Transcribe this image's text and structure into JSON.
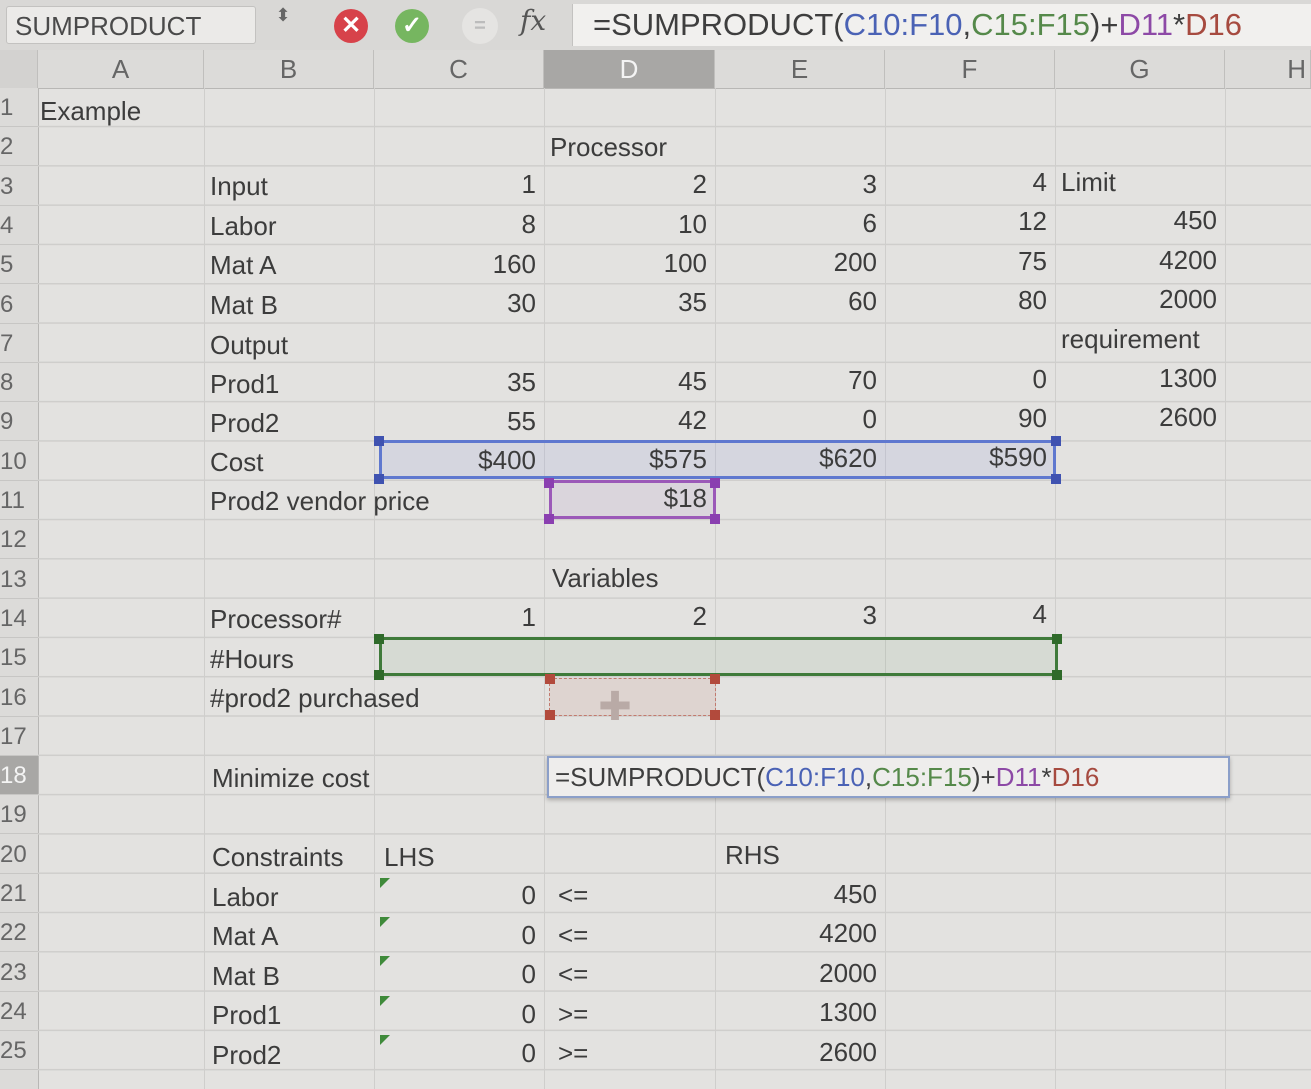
{
  "formula_bar": {
    "name_box": "SUMPRODUCT",
    "name_box_arrows": "⬍",
    "cancel_icon": "✕",
    "accept_icon": "✓",
    "fx_label": "fx",
    "formula_parts": {
      "p1": "=SUMPRODUCT(",
      "p2": "C10:F10",
      "p3": ",",
      "p4": "C15:F15",
      "p5": ")+",
      "p6": "D11",
      "p7": "*",
      "p8": "D16"
    }
  },
  "columns": [
    "A",
    "B",
    "C",
    "D",
    "E",
    "F",
    "G",
    "H"
  ],
  "rows": [
    "1",
    "2",
    "3",
    "4",
    "5",
    "6",
    "7",
    "8",
    "9",
    "10",
    "11",
    "12",
    "13",
    "14",
    "15",
    "16",
    "17",
    "18",
    "19",
    "20",
    "21",
    "22",
    "23",
    "24",
    "25"
  ],
  "cells": {
    "a1": "Example",
    "d2": "Processor",
    "b3": "Input",
    "c3": "1",
    "d3": "2",
    "e3": "3",
    "f3": "4",
    "g3": "Limit",
    "b4": "Labor",
    "c4": "8",
    "d4": "10",
    "e4": "6",
    "f4": "12",
    "g4": "450",
    "b5": "Mat A",
    "c5": "160",
    "d5": "100",
    "e5": "200",
    "f5": "75",
    "g5": "4200",
    "b6": "Mat B",
    "c6": "30",
    "d6": "35",
    "e6": "60",
    "f6": "80",
    "g6": "2000",
    "b7": "Output",
    "g7": "requirement",
    "b8": "Prod1",
    "c8": "35",
    "d8": "45",
    "e8": "70",
    "f8": "0",
    "g8": "1300",
    "b9": "Prod2",
    "c9": "55",
    "d9": "42",
    "e9": "0",
    "f9": "90",
    "g9": "2600",
    "b10": "Cost",
    "c10": "$400",
    "d10": "$575",
    "e10": "$620",
    "f10": "$590",
    "b11": "Prod2 vendor price",
    "d11": "$18",
    "d13": "Variables",
    "b14": "Processor#",
    "c14": "1",
    "d14": "2",
    "e14": "3",
    "f14": "4",
    "b15": "#Hours",
    "b16": "#prod2 purchased",
    "b18": "Minimize cost",
    "b20": "Constraints",
    "c20": "LHS",
    "e20": "RHS",
    "b21": "Labor",
    "c21": "0",
    "d21": "<=",
    "e21": "450",
    "b22": "Mat A",
    "c22": "0",
    "d22": "<=",
    "e22": "4200",
    "b23": "Mat B",
    "c23": "0",
    "d23": "<=",
    "e23": "2000",
    "b24": "Prod1",
    "c24": "0",
    "d24": ">=",
    "e24": "1300",
    "b25": "Prod2",
    "c25": "0",
    "d25": ">=",
    "e25": "2600"
  },
  "editing_cell": {
    "address": "D18",
    "formula_parts": {
      "p1": "=SUMPRODUCT(",
      "p2": "C10:F10",
      "p3": ",",
      "p4": "C15:F15",
      "p5": ")+",
      "p6": "D11",
      "p7": "*",
      "p8": "D16"
    }
  },
  "colors": {
    "ref_blue": "#4a62b5",
    "ref_purple": "#8d49a6",
    "ref_green": "#55894a",
    "ref_brown": "#a64a3f",
    "cancel": "#d7424a",
    "accept": "#76b660"
  }
}
